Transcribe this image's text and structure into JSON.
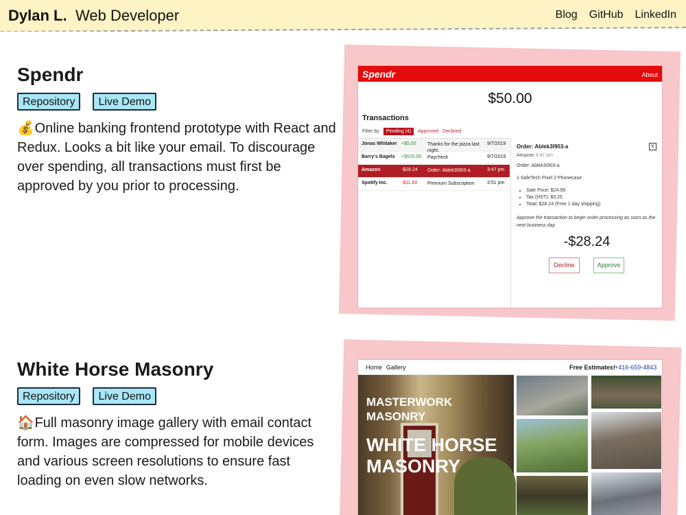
{
  "header": {
    "brand": "Dylan L.",
    "role": "Web Developer",
    "nav": [
      "Blog",
      "GitHub",
      "LinkedIn"
    ]
  },
  "colors": {
    "header_bg": "#fdf3c4",
    "pill_bg": "#a9e6f7",
    "frame_pink": "#f8c7c9",
    "spendr_red": "#e30b0b"
  },
  "projects": [
    {
      "title": "Spendr",
      "buttons": [
        "Repository",
        "Live Demo"
      ],
      "emoji": "💰",
      "description": "Online banking frontend prototype with React and Redux. Looks a bit like your email. To discourage over spending, all transactions must first be approved by you prior to processing."
    },
    {
      "title": "White Horse Masonry",
      "buttons": [
        "Repository",
        "Live Demo"
      ],
      "emoji": "🏠",
      "description": "Full masonry image gallery with email contact form. Images are compressed for mobile devices and various screen resolutions to ensure fast loading on even slow networks."
    }
  ],
  "spendr_app": {
    "logo": "Spendr",
    "about": "About",
    "balance": "$50.00",
    "transactions_heading": "Transactions",
    "filter_label": "Filter by",
    "filters": [
      "Pending (4)",
      "Approved",
      "Declined"
    ],
    "rows": [
      {
        "name": "Jonas Whitaker",
        "amount": "+$5.00",
        "desc": "Thanks for the pizza last night.",
        "date": "9/7/2019"
      },
      {
        "name": "Barry's Bagels",
        "amount": "+$520.00",
        "desc": "Paycheck",
        "date": "9/7/2019"
      },
      {
        "name": "Amazon",
        "amount": "-$28.24",
        "desc": "Order: Ablek3I903-a",
        "date": "3:47 pm"
      },
      {
        "name": "Spotify Inc.",
        "amount": "-$11.60",
        "desc": "Premium Subscription",
        "date": "3:51 pm"
      }
    ],
    "detail": {
      "title": "Order: Ablek3I903-a",
      "close": "X",
      "merchant": "Amazon",
      "time": "3:47 pm",
      "order": "Order: Ablek3I903-a",
      "item": "1 SafeTech Pixel 2 Phonecase:",
      "bullets": [
        "Sale Price: $24.99",
        "Tax (HST): $3.25",
        "Total: $28.24 (Free 1 day shipping)"
      ],
      "note": "Approve the transaction to begin order processing as soon as the next business day.",
      "total": "-$28.24",
      "decline": "Decline",
      "approve": "Approve"
    }
  },
  "masonry_app": {
    "nav": [
      "Home",
      "Gallery"
    ],
    "free_estimates": "Free Estimates!",
    "phone": "+416-659-4843",
    "hero_sub": [
      "MASTERWORK",
      "MASONRY"
    ],
    "hero_title": [
      "WHITE HORSE",
      "MASONRY"
    ]
  }
}
